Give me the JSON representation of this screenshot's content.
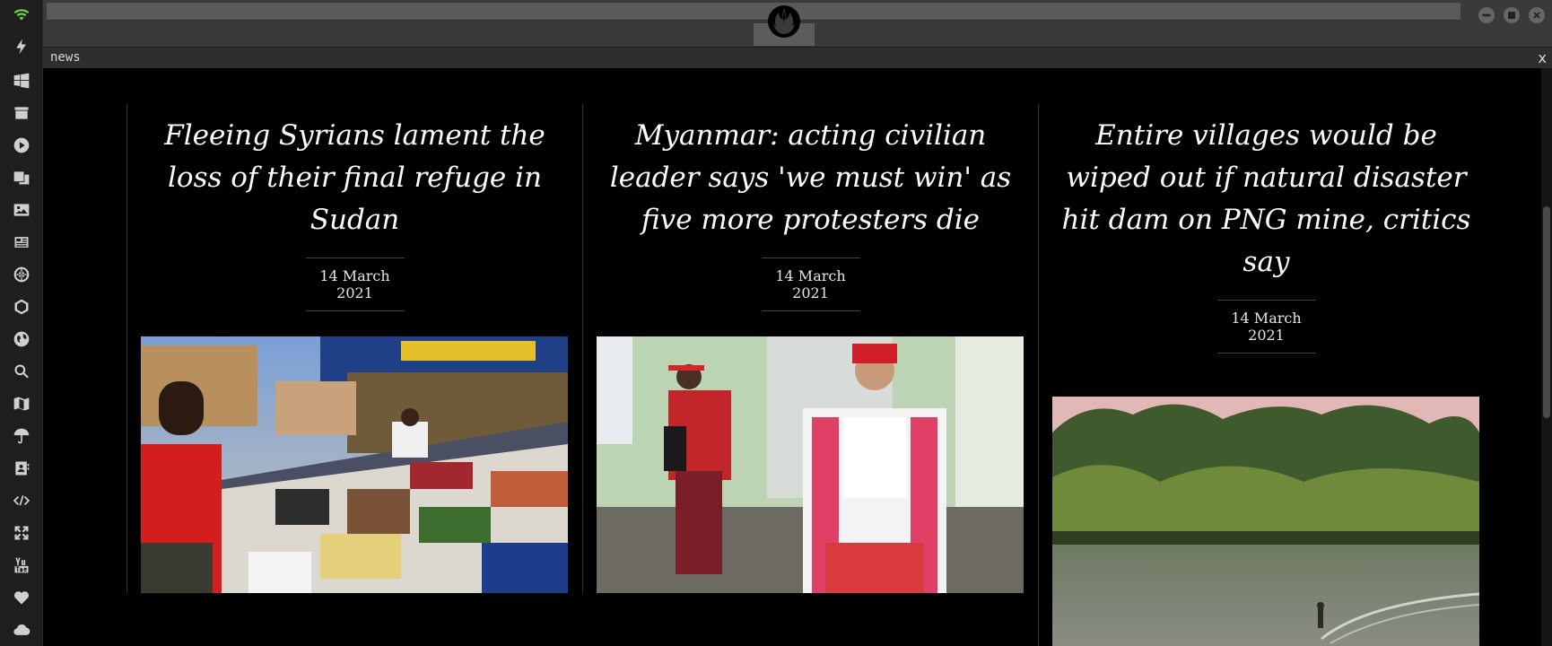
{
  "panel": {
    "title": "news",
    "close_label": "x"
  },
  "dock": {
    "icons": [
      "wifi-icon",
      "bolt-icon",
      "windows-icon",
      "archive-icon",
      "play-icon",
      "translate-icon",
      "image-icon",
      "newspaper-icon",
      "empire-icon",
      "hexagon-icon",
      "globe-icon",
      "search-icon",
      "map-icon",
      "umbrella-icon",
      "contact-card-icon",
      "code-icon",
      "expand-icon",
      "youtube-icon",
      "heart-icon",
      "cloud-icon"
    ]
  },
  "window": {
    "brand_icon": "rebel-alliance-icon"
  },
  "articles": [
    {
      "title": "Fleeing Syrians lament the loss of their final refuge in Sudan",
      "date": "14 March 2021",
      "image": "market-clothing-photo"
    },
    {
      "title": "Myanmar: acting civilian leader says 'we must win' as five more protesters die",
      "date": "14 March 2021",
      "image": "myanmar-leaders-photo"
    },
    {
      "title": "Entire villages would be wiped out if natural disaster hit dam on PNG mine, critics say",
      "date": "14 March 2021",
      "image": "png-river-photo"
    }
  ],
  "colors": {
    "accent": "#6fcf3c",
    "background": "#000000",
    "chrome": "#3a3a3a"
  }
}
